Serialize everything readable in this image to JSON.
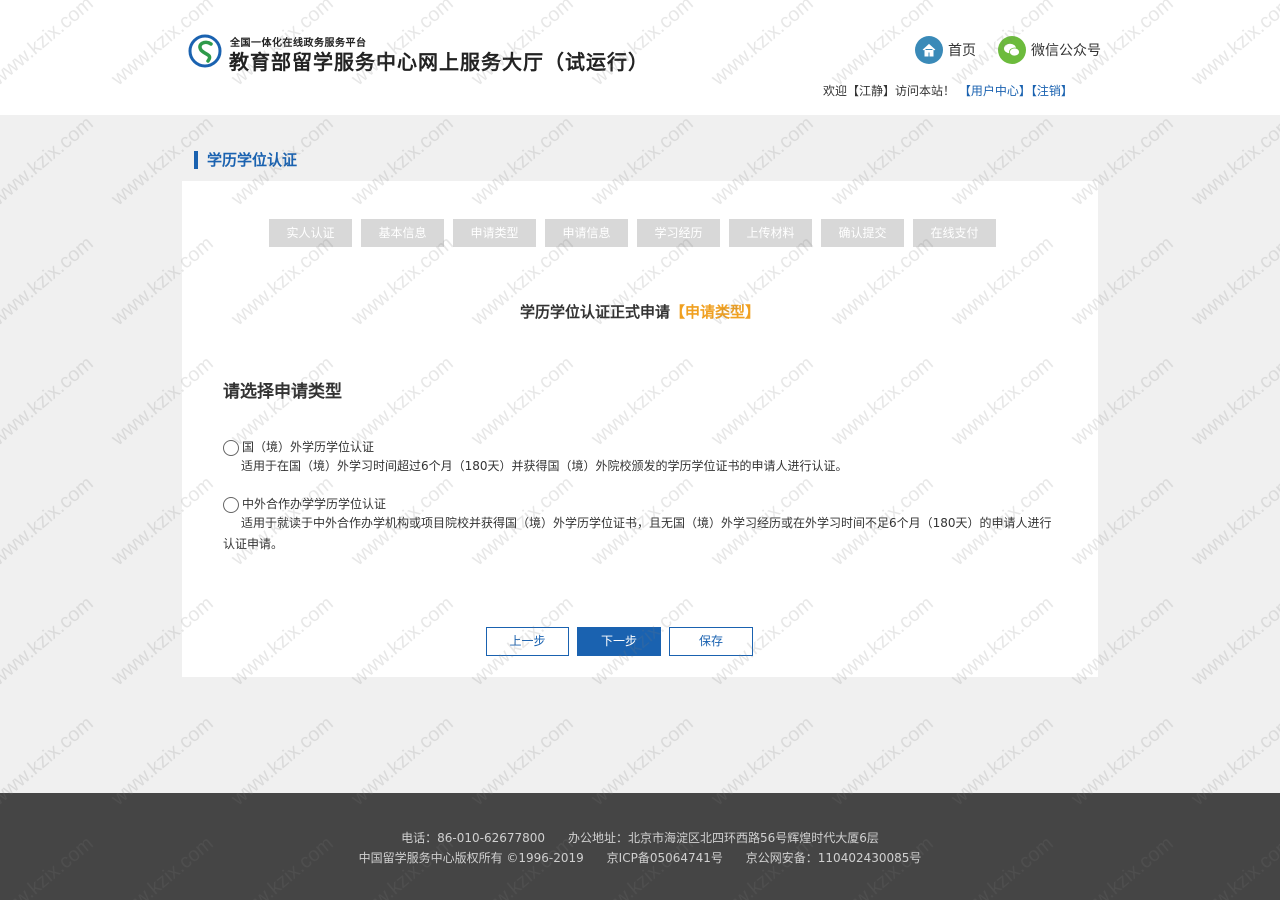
{
  "header": {
    "subtitle": "全国一体化在线政务服务平台",
    "title": "教育部留学服务中心网上服务大厅（试运行）",
    "home_label": "首页",
    "wechat_label": "微信公众号",
    "welcome_prefix": "欢迎【",
    "user_name": "江静",
    "welcome_suffix": "】访问本站！",
    "user_center": "【用户中心】",
    "logout": "【注销】"
  },
  "section_title": "学历学位认证",
  "steps": [
    "实人认证",
    "基本信息",
    "申请类型",
    "申请信息",
    "学习经历",
    "上传材料",
    "确认提交",
    "在线支付"
  ],
  "page_heading": {
    "main": "学历学位认证正式申请",
    "accent": "【申请类型】"
  },
  "choose_title": "请选择申请类型",
  "options": [
    {
      "label": "国（境）外学历学位认证",
      "desc": "适用于在国（境）外学习时间超过6个月（180天）并获得国（境）外院校颁发的学历学位证书的申请人进行认证。"
    },
    {
      "label": "中外合作办学学历学位认证",
      "desc": "适用于就读于中外合作办学机构或项目院校并获得国（境）外学历学位证书，且无国（境）外学习经历或在外学习时间不足6个月（180天）的申请人进行认证申请。"
    }
  ],
  "buttons": {
    "prev": "上一步",
    "next": "下一步",
    "save": "保存"
  },
  "footer": {
    "line1": "电话：86-010-62677800      办公地址：北京市海淀区北四环西路56号辉煌时代大厦6层",
    "line2": "中国留学服务中心版权所有 ©1996-2019      京ICP备05064741号      京公网安备：110402430085号"
  },
  "watermark": "www.kzix.com",
  "colors": {
    "brand_blue": "#1a62b0",
    "accent_orange": "#f0a020",
    "step_gray": "#d8d8d8",
    "footer_bg": "#454545"
  }
}
